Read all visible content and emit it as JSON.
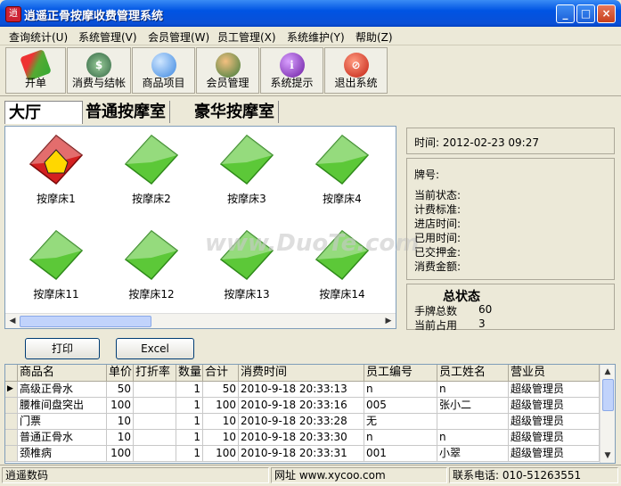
{
  "window": {
    "title": "逍遥正骨按摩收费管理系统"
  },
  "menu": [
    "查询统计(U)",
    "系统管理(V)",
    "会员管理(W)",
    "员工管理(X)",
    "系统维护(Y)",
    "帮助(Z)"
  ],
  "toolbar": [
    {
      "label": "开单",
      "icon": "pencil-icon"
    },
    {
      "label": "消费与结帐",
      "icon": "money-bag-icon"
    },
    {
      "label": "商品项目",
      "icon": "apple-icon"
    },
    {
      "label": "会员管理",
      "icon": "users-icon"
    },
    {
      "label": "系统提示",
      "icon": "info-icon"
    },
    {
      "label": "退出系统",
      "icon": "exit-icon"
    }
  ],
  "tabs": [
    "大厅",
    "普通按摩室",
    "豪华按摩室"
  ],
  "beds": [
    {
      "label": "按摩床1",
      "status": "occupied"
    },
    {
      "label": "按摩床2",
      "status": "free"
    },
    {
      "label": "按摩床3",
      "status": "free"
    },
    {
      "label": "按摩床4",
      "status": "free"
    },
    {
      "label": "按摩床11",
      "status": "free"
    },
    {
      "label": "按摩床12",
      "status": "free"
    },
    {
      "label": "按摩床13",
      "status": "free"
    },
    {
      "label": "按摩床14",
      "status": "free"
    }
  ],
  "info": {
    "time": "时间: 2012-02-23 09:27",
    "tag": "牌号:",
    "fields": [
      "当前状态:",
      "计费标准:",
      "进店时间:",
      "已用时间:",
      "已交押金:",
      "消费金额:"
    ]
  },
  "status": {
    "title": "总状态",
    "total_label": "手牌总数",
    "total_value": "60",
    "used_label": "当前占用",
    "used_value": "3"
  },
  "buttons": {
    "print": "打印",
    "excel": "Excel"
  },
  "table": {
    "headers": [
      "商品名",
      "单价",
      "打折率",
      "数量",
      "合计",
      "消费时间",
      "员工编号",
      "员工姓名",
      "营业员"
    ],
    "rows": [
      [
        "高级正骨水",
        "50",
        "",
        "1",
        "50",
        "2010-9-18  20:33:13",
        "n",
        "n",
        "超级管理员"
      ],
      [
        "腰椎间盘突出",
        "100",
        "",
        "1",
        "100",
        "2010-9-18  20:33:16",
        "005",
        "张小二",
        "超级管理员"
      ],
      [
        "门票",
        "10",
        "",
        "1",
        "10",
        "2010-9-18  20:33:28",
        "无",
        "",
        "超级管理员"
      ],
      [
        "普通正骨水",
        "10",
        "",
        "1",
        "10",
        "2010-9-18  20:33:30",
        "n",
        "n",
        "超级管理员"
      ],
      [
        "颈椎病",
        "100",
        "",
        "1",
        "100",
        "2010-9-18  20:33:31",
        "001",
        "小翠",
        "超级管理员"
      ]
    ]
  },
  "statusbar": {
    "company": "逍遥数码",
    "website": "网址 www.xycoo.com",
    "phone": "联系电话: 010-51263551"
  },
  "watermark": "www.DuoTe.com",
  "colors": {
    "title": "#0054e3",
    "free": "#5cc838",
    "occupied": "#d42020"
  }
}
